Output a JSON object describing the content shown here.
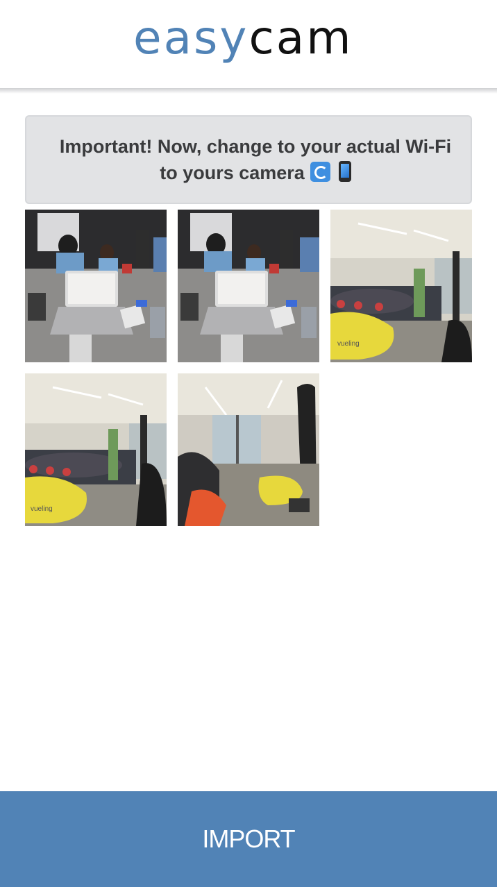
{
  "header": {
    "logo_part1": "easy",
    "logo_part2": "cam"
  },
  "notice": {
    "text": "Important! Now, change to your actual Wi-Fi to yours camera",
    "icons": [
      "arrows-cycle-icon",
      "mobile-phone-icon"
    ]
  },
  "gallery": {
    "photos": [
      {
        "scene": "desk-with-laptop"
      },
      {
        "scene": "desk-with-laptop"
      },
      {
        "scene": "hall-with-yellow-bean-bag"
      },
      {
        "scene": "hall-with-yellow-bean-bag"
      },
      {
        "scene": "hall-with-pillar"
      }
    ],
    "bean_bag_brand": "vueling"
  },
  "footer": {
    "import_label": "IMPORT"
  },
  "colors": {
    "brand_blue": "#5183b6",
    "notice_bg": "#e2e3e5",
    "notice_text": "#3a3b3d"
  }
}
